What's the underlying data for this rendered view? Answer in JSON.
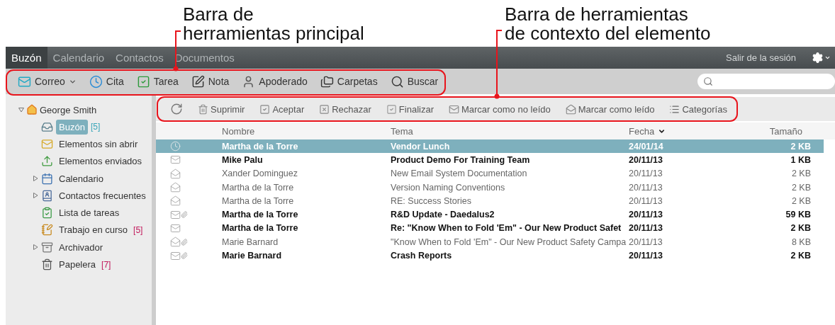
{
  "annotations": [
    {
      "lines": [
        "Barra de",
        "herramientas principal"
      ]
    },
    {
      "lines": [
        "Barra de herramientas",
        "de contexto del elemento"
      ]
    }
  ],
  "nav": {
    "tabs": [
      {
        "label": "Buzón",
        "selected": true
      },
      {
        "label": "Calendario",
        "selected": false
      },
      {
        "label": "Contactos",
        "selected": false
      },
      {
        "label": "Documentos",
        "selected": false
      }
    ],
    "logout": "Salir de la sesión"
  },
  "toolbar": {
    "items": [
      {
        "label": "Correo",
        "kind": "mail",
        "dropdown": true
      },
      {
        "label": "Cita",
        "kind": "clock",
        "dropdown": false
      },
      {
        "label": "Tarea",
        "kind": "task",
        "dropdown": false
      },
      {
        "label": "Nota",
        "kind": "note",
        "dropdown": false
      },
      {
        "label": "Apoderado",
        "kind": "person",
        "dropdown": false
      },
      {
        "label": "Carpetas",
        "kind": "folders",
        "dropdown": false
      },
      {
        "label": "Buscar",
        "kind": "search",
        "dropdown": false
      }
    ]
  },
  "sidebar": {
    "account": {
      "name": "George Smith",
      "expanded": true
    },
    "folders": [
      {
        "label": "Buzón",
        "kind": "inbox",
        "count": "[5]",
        "color": "#3aa6b9",
        "selected": true,
        "has_children": false
      },
      {
        "label": "Elementos sin abrir",
        "kind": "unopened",
        "selected": false,
        "has_children": false
      },
      {
        "label": "Elementos enviados",
        "kind": "sent",
        "selected": false,
        "has_children": false
      },
      {
        "label": "Calendario",
        "kind": "calendar",
        "selected": false,
        "has_children": true
      },
      {
        "label": "Contactos frecuentes",
        "kind": "contacts",
        "selected": false,
        "has_children": true
      },
      {
        "label": "Lista de tareas",
        "kind": "tasks",
        "selected": false,
        "has_children": false
      },
      {
        "label": "Trabajo en curso",
        "kind": "work",
        "count": "[5]",
        "color": "#c2185b",
        "selected": false,
        "has_children": false
      },
      {
        "label": "Archivador",
        "kind": "cabinet",
        "selected": false,
        "has_children": true
      },
      {
        "label": "Papelera",
        "kind": "trash",
        "count": "[7]",
        "color": "#c2185b",
        "selected": false,
        "has_children": false
      }
    ]
  },
  "context_toolbar": {
    "items": [
      {
        "kind": "refresh"
      },
      {
        "label": "Suprimir",
        "kind": "trash"
      },
      {
        "label": "Aceptar",
        "kind": "accept"
      },
      {
        "label": "Rechazar",
        "kind": "decline"
      },
      {
        "label": "Finalizar",
        "kind": "complete"
      },
      {
        "label": "Marcar como no leído",
        "kind": "envelope"
      },
      {
        "label": "Marcar como leído",
        "kind": "open-envelope"
      },
      {
        "label": "Categorías",
        "kind": "list"
      }
    ]
  },
  "table": {
    "columns": [
      {
        "label": "Nombre",
        "sorted": false
      },
      {
        "label": "Tema",
        "sorted": false
      },
      {
        "label": "Fecha",
        "sorted": true
      },
      {
        "label": "Tamaño",
        "sorted": false
      }
    ],
    "rows": [
      {
        "kind": "appointment",
        "attachment": false,
        "unread": true,
        "selected": true,
        "name": "Martha de la Torre",
        "subject": "Vendor Lunch",
        "date": "24/01/14",
        "size": "2 KB"
      },
      {
        "kind": "closed",
        "attachment": false,
        "unread": true,
        "selected": false,
        "name": "Mike Palu",
        "subject": "Product Demo For Training Team",
        "date": "20/11/13",
        "size": "1 KB"
      },
      {
        "kind": "opened",
        "attachment": false,
        "unread": false,
        "selected": false,
        "name": "Xander Dominguez",
        "subject": "New Email System Documentation",
        "date": "20/11/13",
        "size": "2 KB"
      },
      {
        "kind": "opened",
        "attachment": false,
        "unread": false,
        "selected": false,
        "name": "Martha de la Torre",
        "subject": "Version Naming Conventions",
        "date": "20/11/13",
        "size": "2 KB"
      },
      {
        "kind": "opened",
        "attachment": false,
        "unread": false,
        "selected": false,
        "name": "Martha de la Torre",
        "subject": "RE: Success Stories",
        "date": "20/11/13",
        "size": "2 KB"
      },
      {
        "kind": "closed",
        "attachment": true,
        "unread": true,
        "selected": false,
        "name": "Martha de la Torre",
        "subject": "R&D Update - Daedalus2",
        "date": "20/11/13",
        "size": "59 KB"
      },
      {
        "kind": "closed",
        "attachment": false,
        "unread": true,
        "selected": false,
        "name": "Martha de la Torre",
        "subject": "Re: \"Know When to Fold 'Em\" - Our New Product Safet",
        "date": "20/11/13",
        "size": "2 KB"
      },
      {
        "kind": "opened",
        "attachment": true,
        "unread": false,
        "selected": false,
        "name": "Marie Barnard",
        "subject": "\"Know When to Fold 'Em\" - Our New Product Safety Campa",
        "date": "20/11/13",
        "size": "8 KB"
      },
      {
        "kind": "closed",
        "attachment": true,
        "unread": true,
        "selected": false,
        "name": "Marie Barnard",
        "subject": "Crash Reports",
        "date": "20/11/13",
        "size": "2 KB"
      }
    ]
  }
}
